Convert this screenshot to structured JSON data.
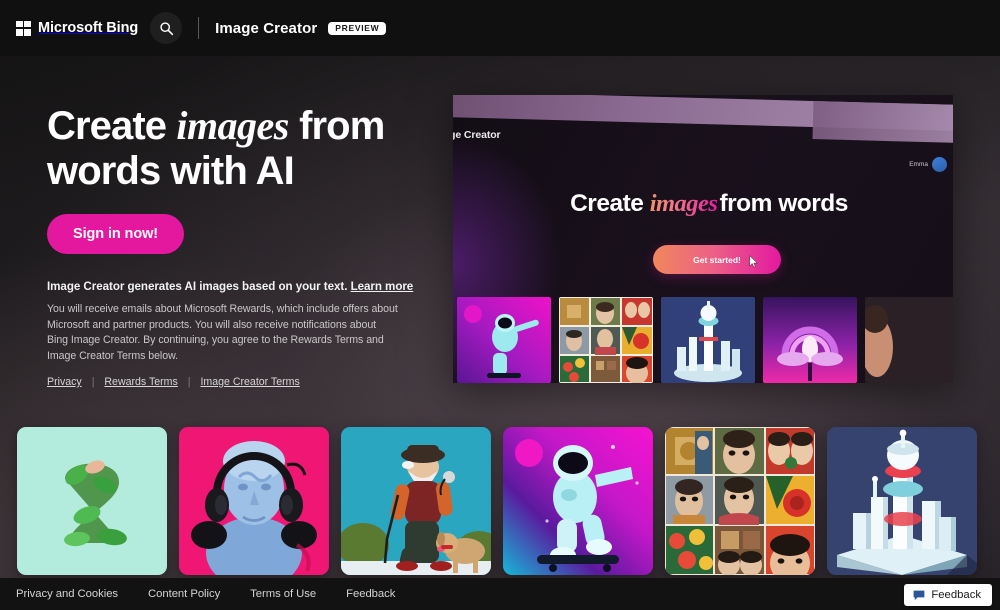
{
  "header": {
    "brand": "Microsoft Bing",
    "logo_icon": "microsoft-grid-icon",
    "search_icon": "search-icon",
    "title": "Image Creator",
    "badge": "PREVIEW"
  },
  "hero": {
    "heading_part1": "Create ",
    "heading_italic": "images",
    "heading_part2": " from words with AI",
    "heading_line1_a": "Create ",
    "heading_line1_it": "images",
    "heading_line1_b": " from",
    "heading_line2": "words with AI",
    "signin_label": "Sign in now!",
    "disclaimer_title": "Image Creator generates AI images based on your text.",
    "learn_more": "Learn more",
    "disclaimer_body": "You will receive emails about Microsoft Rewards, which include offers about Microsoft and partner products. You will also receive notifications about Bing Image Creator. By continuing, you agree to the Rewards Terms and Image Creator Terms below.",
    "links": [
      {
        "label": "Privacy"
      },
      {
        "label": "Rewards Terms"
      },
      {
        "label": "Image Creator Terms"
      }
    ],
    "link_separator": "|"
  },
  "mockup": {
    "app_title": "ge Creator",
    "user_name": "Emma",
    "avatar_icon": "user-avatar",
    "heading_a": "Create ",
    "heading_it": "images",
    "heading_b": "from words",
    "cta_label": "Get started!",
    "cursor_icon": "mouse-cursor-icon",
    "thumbnails": [
      {
        "name": "astronaut-neon-space"
      },
      {
        "name": "portrait-art-grid"
      },
      {
        "name": "isometric-white-city"
      },
      {
        "name": "purple-rainbow-clouds"
      },
      {
        "name": "partial-portrait"
      }
    ]
  },
  "gallery": {
    "items": [
      {
        "name": "leafy-number-two",
        "alt": "Number 2 made of green leaves on mint background"
      },
      {
        "name": "david-bust-headphones",
        "alt": "Blue classical bust wearing headphones on pink background"
      },
      {
        "name": "old-man-walking-dog",
        "alt": "Elderly man with cane walking a dog on teal background"
      },
      {
        "name": "astronaut-skateboard",
        "alt": "Astronaut skateboarding in neon magenta space"
      },
      {
        "name": "portrait-art-grid",
        "alt": "Grid of nine painted portraits and flowers"
      },
      {
        "name": "isometric-city",
        "alt": "Isometric white and teal futuristic city tower"
      }
    ]
  },
  "footer": {
    "links": [
      {
        "label": "Privacy and Cookies"
      },
      {
        "label": "Content Policy"
      },
      {
        "label": "Terms of Use"
      },
      {
        "label": "Feedback"
      }
    ],
    "feedback_button": "Feedback",
    "feedback_icon": "speech-bubble-icon"
  },
  "colors": {
    "accent_pink": "#e3189f",
    "accent_orange": "#f0885c",
    "page_bg": "#1c1a1c",
    "header_bg": "#111010",
    "feedback_blue": "#2b579a"
  }
}
